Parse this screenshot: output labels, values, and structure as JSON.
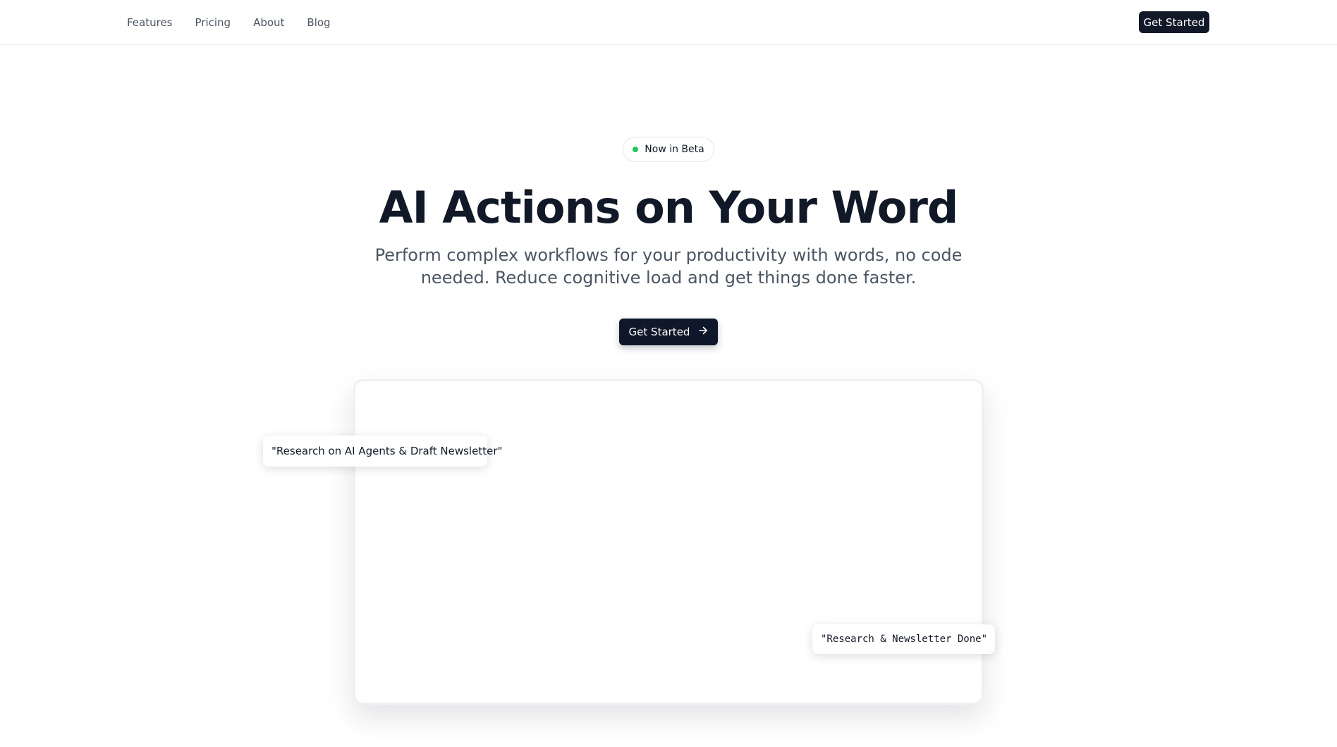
{
  "nav": {
    "links": [
      "Features",
      "Pricing",
      "About",
      "Blog"
    ],
    "cta_label": "Get Started"
  },
  "hero": {
    "badge": "Now in Beta",
    "title": "AI Actions on Your Word",
    "subtitle": "Perform complex workflows for your productivity with words, no code needed. Reduce cognitive load and get things done faster.",
    "cta_label": "Get Started",
    "cta_icon": "arrow-right-icon"
  },
  "demo": {
    "request_text": "\"Research on AI Agents & Draft Newsletter\"",
    "result_text": "\"Research & Newsletter Done\""
  },
  "colors": {
    "primary_dark": "#0f172a",
    "beta_dot": "#22c55e",
    "text_muted": "#4b5563",
    "border": "#e5e7eb"
  }
}
